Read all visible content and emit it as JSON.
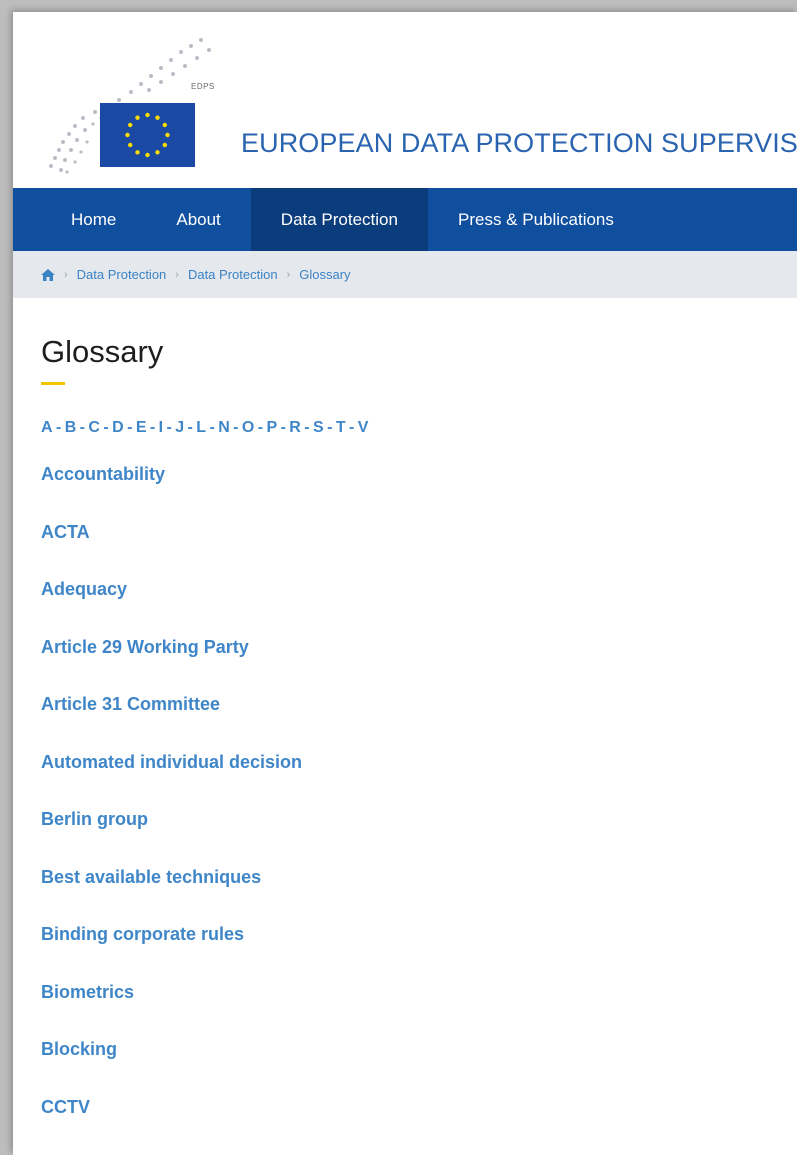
{
  "header": {
    "tag": "EDPS",
    "title": "EUROPEAN DATA PROTECTION SUPERVISOR"
  },
  "nav": {
    "items": [
      {
        "label": "Home"
      },
      {
        "label": "About"
      },
      {
        "label": "Data Protection"
      },
      {
        "label": "Press & Publications"
      }
    ]
  },
  "breadcrumb": {
    "icon": "home-icon",
    "items": [
      "Data Protection",
      "Data Protection",
      "Glossary"
    ]
  },
  "page": {
    "title": "Glossary"
  },
  "alphabet": [
    "A",
    "B",
    "C",
    "D",
    "E",
    "I",
    "J",
    "L",
    "N",
    "O",
    "P",
    "R",
    "S",
    "T",
    "V"
  ],
  "glossary": [
    "Accountability",
    "ACTA",
    "Adequacy",
    "Article 29 Working Party",
    "Article 31 Committee",
    "Automated individual decision",
    "Berlin group",
    "Best available techniques",
    "Binding corporate rules",
    "Biometrics",
    "Blocking",
    "CCTV"
  ],
  "colors": {
    "nav": "#0f4f9e",
    "nav_active": "#0b3c7c",
    "link": "#3f86c8",
    "accent": "#f5c400"
  }
}
